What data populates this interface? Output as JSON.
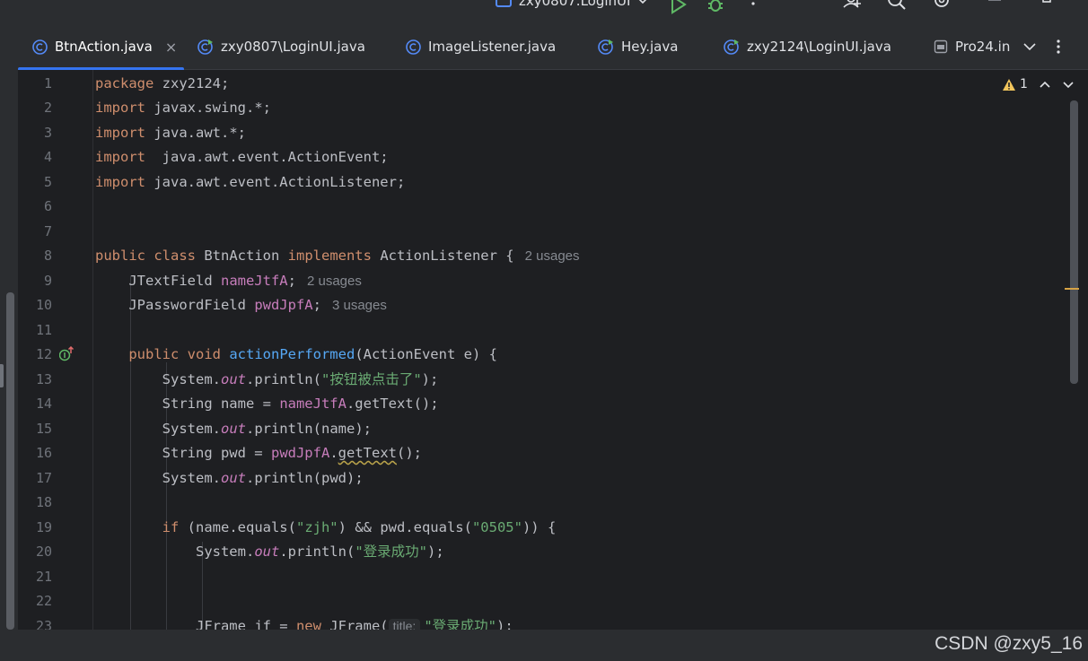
{
  "window": {
    "config_name": "zxy0807.LoginUI"
  },
  "tabs": [
    {
      "label": "BtnAction.java",
      "active": true
    },
    {
      "label": "zxy0807\\LoginUI.java"
    },
    {
      "label": "ImageListener.java"
    },
    {
      "label": "Hey.java"
    },
    {
      "label": "zxy2124\\LoginUI.java"
    },
    {
      "label": "Pro24.in"
    }
  ],
  "inspection": {
    "warning_count": "1"
  },
  "code": {
    "lines": [
      "1",
      "2",
      "3",
      "4",
      "5",
      "6",
      "7",
      "8",
      "9",
      "10",
      "11",
      "12",
      "13",
      "14",
      "15",
      "16",
      "17",
      "18",
      "19",
      "20",
      "21",
      "22",
      "23"
    ],
    "t": {
      "package": "package",
      "pkg_name": " zxy2124;",
      "import": "import",
      "imp1": " javax.swing.*;",
      "imp2": " java.awt.*;",
      "imp3": "  java.awt.event.ActionEvent;",
      "imp4": " java.awt.event.ActionListener;",
      "public": "public",
      "class": " class",
      "class_name": " BtnAction ",
      "implements": "implements",
      "iface": " ActionListener {",
      "usages_2": "2 usages",
      "usages_3": "3 usages",
      "jtf_type": "JTextField ",
      "name_field": "nameJtfA",
      "semi": ";",
      "jpf_type": "JPasswordField ",
      "pwd_field": "pwdJpfA",
      "void": " void ",
      "method": "actionPerformed",
      "params": "(ActionEvent e) {",
      "system": "System.",
      "out": "out",
      "println": ".println(",
      "str_clicked": "\"按钮被点击了\"",
      "close": ");",
      "string_name": "String name = ",
      "gettext": ".getText();",
      "name_arg": "name",
      "string_pwd": "String pwd = ",
      "dot": ".",
      "gettext_m": "getText",
      "call_end": "();",
      "pwd_arg": "pwd",
      "if": "if",
      "cond1": " (name.equals(",
      "str_zjh": "\"zjh\"",
      "cond2": ") && pwd.equals(",
      "str_0505": "\"0505\"",
      "cond3": ")) {",
      "str_success": "\"登录成功\"",
      "jframe_decl": "JFrame jf = ",
      "new": "new",
      "jframe_ctor": " JFrame(",
      "title_hint": "title:",
      "jframe_end": ");"
    }
  },
  "watermark": "CSDN @zxy5_16"
}
